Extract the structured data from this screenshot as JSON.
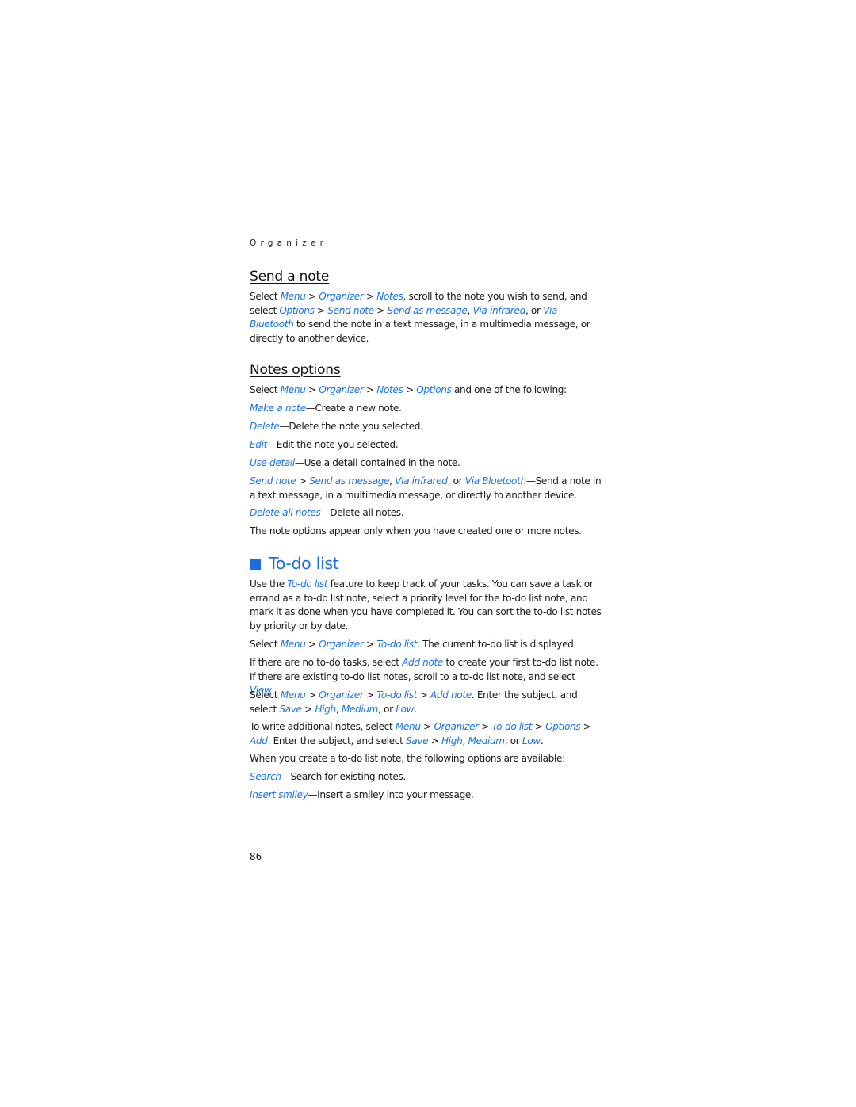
{
  "running_header": "Organizer",
  "page_number": "86",
  "colors": {
    "link": "#1a73e8",
    "heading_accent": "#1a6fe0",
    "text": "#1a1a1a"
  },
  "send_note": {
    "heading": "Send a note",
    "para": {
      "t0": "Select ",
      "l0": "Menu",
      "s0": " > ",
      "l1": "Organizer",
      "s1": " > ",
      "l2": "Notes",
      "t1": ", scroll to the note you wish to send, and select ",
      "l3": "Options",
      "s2": " > ",
      "l4": "Send note",
      "s3": " > ",
      "l5": "Send as message",
      "s4": ", ",
      "l6": "Via infrared",
      "s5": ", or ",
      "l7": "Via Bluetooth",
      "t2": " to send the note in a text message, in a multimedia message, or directly to another device."
    }
  },
  "notes_options": {
    "heading": "Notes options",
    "intro": {
      "t0": "Select ",
      "l0": "Menu",
      "s0": " > ",
      "l1": "Organizer",
      "s1": " > ",
      "l2": "Notes",
      "s2": " > ",
      "l3": "Options",
      "t1": " and one of the following:"
    },
    "items": [
      {
        "term": "Make a note",
        "desc": "—Create a new note."
      },
      {
        "term": "Delete",
        "desc": "—Delete the note you selected."
      },
      {
        "term": "Edit",
        "desc": "—Edit the note you selected."
      },
      {
        "term": "Use detail",
        "desc": "—Use a detail contained in the note."
      }
    ],
    "send_item": {
      "l0": "Send note",
      "s0": " > ",
      "l1": "Send as message",
      "s1": ", ",
      "l2": "Via infrared",
      "s2": ", or ",
      "l3": "Via Bluetooth",
      "desc": "—Send a note in a text message, in a multimedia message, or directly to another device."
    },
    "delete_all": {
      "term": "Delete all notes",
      "desc": "—Delete all notes."
    },
    "footnote": "The note options appear only when you have created one or more notes."
  },
  "todo": {
    "heading": "To-do list",
    "p1": {
      "t0": "Use the ",
      "l0": "To-do list",
      "t1": " feature to keep track of your tasks. You can save a task or errand as a to-do list note, select a priority level for the to-do list note, and mark it as done when you have completed it. You can sort the to-do list notes by priority or by date."
    },
    "p2": {
      "t0": "Select ",
      "l0": "Menu",
      "s0": " > ",
      "l1": "Organizer",
      "s1": " > ",
      "l2": "To-do list",
      "t1": ". The current to-do list is displayed."
    },
    "p3": {
      "t0": "If there are no to-do tasks, select ",
      "l0": "Add note",
      "t1": " to create your first to-do list note. If there are existing to-do list notes, scroll to a to-do list note, and select ",
      "l1": "View",
      "t2": "."
    },
    "p4": {
      "t0": "Select ",
      "l0": "Menu",
      "s0": " > ",
      "l1": "Organizer",
      "s1": " > ",
      "l2": "To-do list",
      "s2": " > ",
      "l3": "Add note",
      "t1": ". Enter the subject, and select ",
      "l4": "Save",
      "s3": " > ",
      "l5": "High",
      "s4": ", ",
      "l6": "Medium",
      "s5": ", or ",
      "l7": "Low",
      "t2": "."
    },
    "p5": {
      "t0": "To write additional notes, select ",
      "l0": "Menu",
      "s0": " > ",
      "l1": "Organizer",
      "s1": " > ",
      "l2": "To-do list",
      "s2": " > ",
      "l3": "Options",
      "s3": " > ",
      "l4": "Add",
      "t1": ". Enter the subject, and select ",
      "l5": "Save",
      "s4": " > ",
      "l6": "High",
      "s5": ", ",
      "l7": "Medium",
      "s6": ", or ",
      "l8": "Low",
      "t2": "."
    },
    "p6": "When you create a to-do list note, the following options are available:",
    "items": [
      {
        "term": "Search",
        "desc": "—Search for existing notes."
      },
      {
        "term": "Insert smiley",
        "desc": "—Insert a smiley into your message."
      }
    ]
  }
}
